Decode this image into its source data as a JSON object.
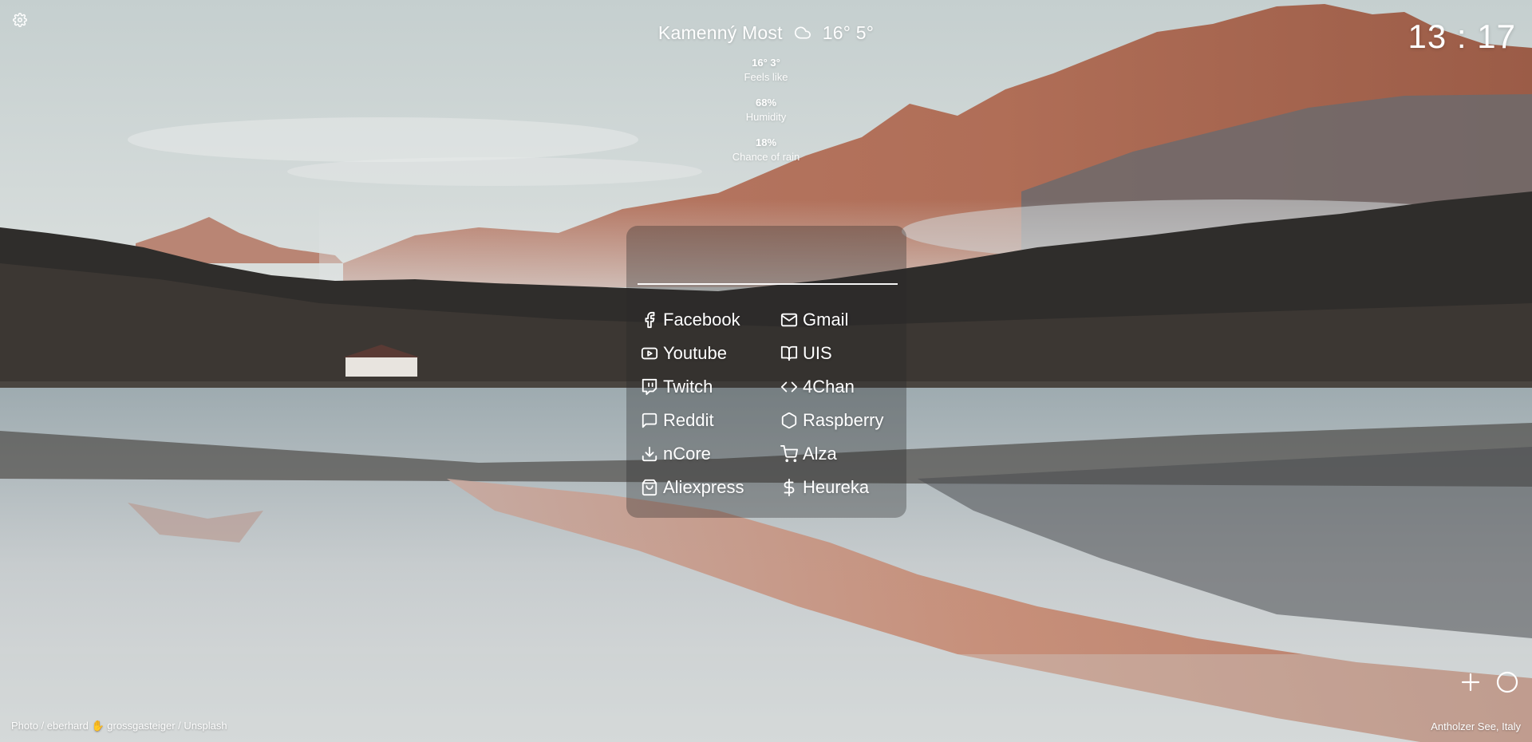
{
  "weather": {
    "location": "Kamenný Most",
    "icon": "cloud-icon",
    "temp_high": "16°",
    "temp_low": "5°",
    "stats": [
      {
        "value": "16° 3°",
        "label": "Feels like"
      },
      {
        "value": "68%",
        "label": "Humidity"
      },
      {
        "value": "18%",
        "label": "Chance of rain"
      }
    ]
  },
  "clock": {
    "time": "13 : 17"
  },
  "search": {
    "value": "",
    "placeholder": ""
  },
  "links": [
    {
      "label": "Facebook",
      "icon": "facebook-icon"
    },
    {
      "label": "Gmail",
      "icon": "mail-icon"
    },
    {
      "label": "Youtube",
      "icon": "youtube-icon"
    },
    {
      "label": "UIS",
      "icon": "book-open-icon"
    },
    {
      "label": "Twitch",
      "icon": "twitch-icon"
    },
    {
      "label": "4Chan",
      "icon": "code-icon"
    },
    {
      "label": "Reddit",
      "icon": "message-square-icon"
    },
    {
      "label": "Raspberry",
      "icon": "hexagon-icon"
    },
    {
      "label": "nCore",
      "icon": "download-icon"
    },
    {
      "label": "Alza",
      "icon": "shopping-cart-icon"
    },
    {
      "label": "Aliexpress",
      "icon": "shopping-bag-icon"
    },
    {
      "label": "Heureka",
      "icon": "dollar-sign-icon"
    }
  ],
  "footer": {
    "credit": "Photo / eberhard ✋ grossgasteiger / Unsplash",
    "location": "Antholzer See, Italy"
  },
  "colors": {
    "panel_bg": "rgba(40,40,40,0.34)",
    "text": "#ffffff"
  }
}
